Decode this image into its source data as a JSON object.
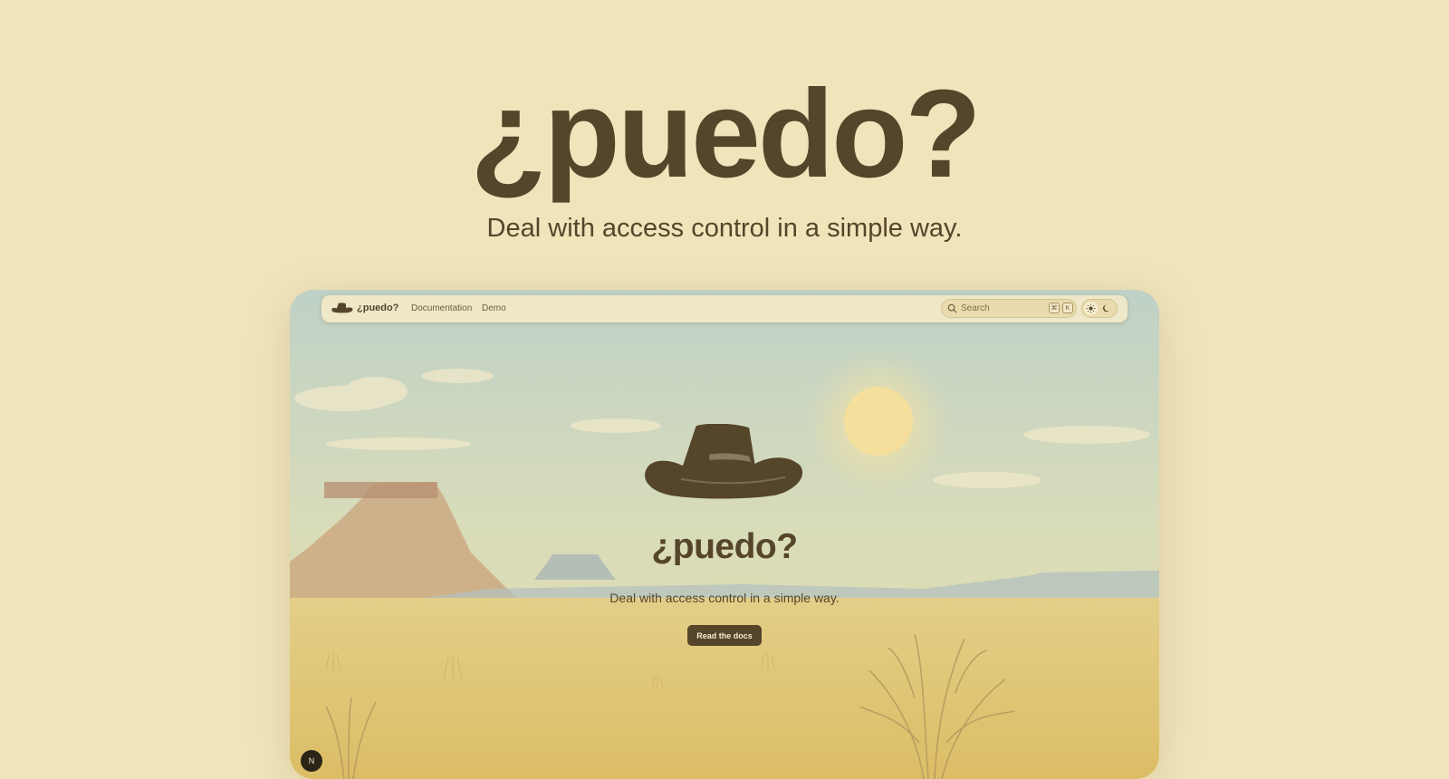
{
  "hero": {
    "title": "¿puedo?",
    "subtitle": "Deal with access control in a simple way."
  },
  "preview": {
    "navbar": {
      "logo_icon": "cowboy-hat-icon",
      "brand": "¿puedo?",
      "links": [
        "Documentation",
        "Demo"
      ],
      "search": {
        "placeholder": "Search",
        "icon": "search-icon",
        "shortcut_keys": [
          "⌘",
          "K"
        ]
      },
      "theme_toggle": {
        "options": [
          "sun-icon",
          "moon-icon"
        ],
        "active": "sun-icon"
      }
    },
    "content": {
      "hat_icon": "cowboy-hat-icon",
      "title": "¿puedo?",
      "subtitle": "Deal with access control in a simple way.",
      "cta_label": "Read the docs"
    },
    "badge": {
      "label": "N",
      "icon": "nextjs-icon"
    }
  },
  "colors": {
    "background": "#f1e4bb",
    "text": "#55452a",
    "button": "#55452a",
    "sky": "#c4d3c2",
    "desert": "#e2c97a"
  }
}
